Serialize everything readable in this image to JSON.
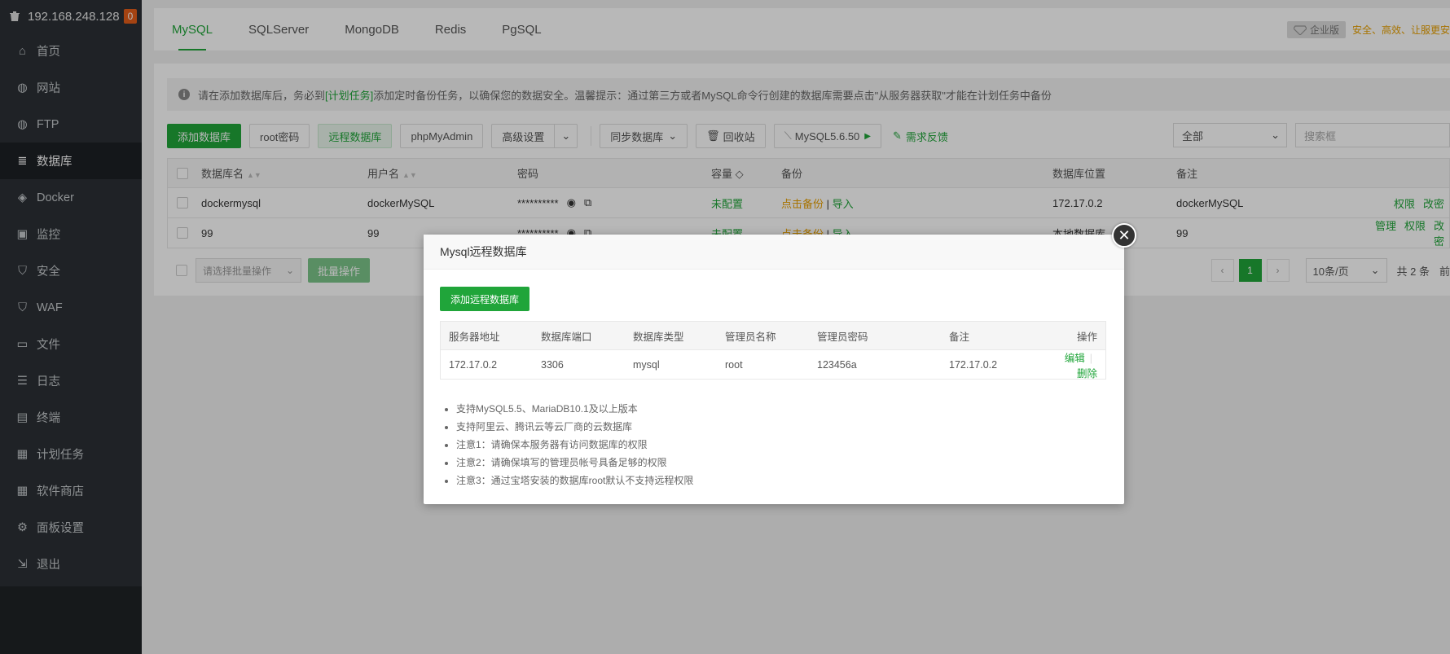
{
  "sidebar": {
    "host": "192.168.248.128",
    "badge": "0",
    "items": [
      {
        "label": "首页",
        "icon": "home-icon"
      },
      {
        "label": "网站",
        "icon": "globe-icon"
      },
      {
        "label": "FTP",
        "icon": "ftp-icon"
      },
      {
        "label": "数据库",
        "icon": "database-icon"
      },
      {
        "label": "Docker",
        "icon": "docker-icon"
      },
      {
        "label": "监控",
        "icon": "monitor-icon"
      },
      {
        "label": "安全",
        "icon": "shield-icon"
      },
      {
        "label": "WAF",
        "icon": "waf-icon"
      },
      {
        "label": "文件",
        "icon": "folder-icon"
      },
      {
        "label": "日志",
        "icon": "log-icon"
      },
      {
        "label": "终端",
        "icon": "terminal-icon"
      },
      {
        "label": "计划任务",
        "icon": "calendar-icon"
      },
      {
        "label": "软件商店",
        "icon": "apps-icon"
      },
      {
        "label": "面板设置",
        "icon": "gear-icon"
      },
      {
        "label": "退出",
        "icon": "logout-icon"
      }
    ],
    "active": "数据库"
  },
  "tabs": [
    "MySQL",
    "SQLServer",
    "MongoDB",
    "Redis",
    "PgSQL"
  ],
  "active_tab": "MySQL",
  "enterprise": {
    "tag": "企业版",
    "promo": "安全、高效、让服更安"
  },
  "notice": {
    "prefix": "请在添加数据库后，务必到",
    "link": "[计划任务]",
    "suffix": "添加定时备份任务，以确保您的数据安全。温馨提示：通过第三方或者MySQL命令行创建的数据库需要点击\"从服务器获取\"才能在计划任务中备份"
  },
  "toolbar": {
    "add_db": "添加数据库",
    "root_pwd": "root密码",
    "remote_db": "远程数据库",
    "phpmyadmin": "phpMyAdmin",
    "advanced": "高级设置",
    "sync": "同步数据库",
    "recycle": "回收站",
    "mysql_version": "MySQL5.6.50",
    "feedback": "需求反馈",
    "filter_value": "全部",
    "search_placeholder": "搜索框"
  },
  "table": {
    "headers": [
      "数据库名",
      "用户名",
      "密码",
      "容量",
      "备份",
      "数据库位置",
      "备注"
    ],
    "rows": [
      {
        "name": "dockermysql",
        "user": "dockerMySQL",
        "pwd": "**********",
        "cap": "未配置",
        "backup": "点击备份",
        "import": "导入",
        "loc": "172.17.0.2",
        "note": "dockerMySQL",
        "ops": [
          "权限",
          "改密"
        ]
      },
      {
        "name": "99",
        "user": "99",
        "pwd": "**********",
        "cap": "未配置",
        "backup": "点击备份",
        "import": "导入",
        "loc": "本地数据库",
        "note": "99",
        "ops": [
          "管理",
          "权限",
          "改密"
        ]
      }
    ]
  },
  "footer": {
    "batch_placeholder": "请选择批量操作",
    "batch_btn": "批量操作",
    "page": "1",
    "page_size": "10条/页",
    "total": "共 2 条",
    "tail": "前"
  },
  "modal": {
    "title": "Mysql远程数据库",
    "add_btn": "添加远程数据库",
    "headers": [
      "服务器地址",
      "数据库端口",
      "数据库类型",
      "管理员名称",
      "管理员密码",
      "备注",
      "操作"
    ],
    "rows": [
      {
        "host": "172.17.0.2",
        "port": "3306",
        "type": "mysql",
        "admin": "root",
        "pwd": "123456a",
        "note": "172.17.0.2",
        "edit": "编辑",
        "delete": "删除"
      }
    ],
    "tips": [
      "支持MySQL5.5、MariaDB10.1及以上版本",
      "支持阿里云、腾讯云等云厂商的云数据库",
      "注意1：请确保本服务器有访问数据库的权限",
      "注意2：请确保填写的管理员帐号具备足够的权限",
      "注意3：通过宝塔安装的数据库root默认不支持远程权限"
    ]
  },
  "colors": {
    "accent": "#20a53a",
    "sidebar": "#2b3035",
    "warn": "#e8a000"
  }
}
